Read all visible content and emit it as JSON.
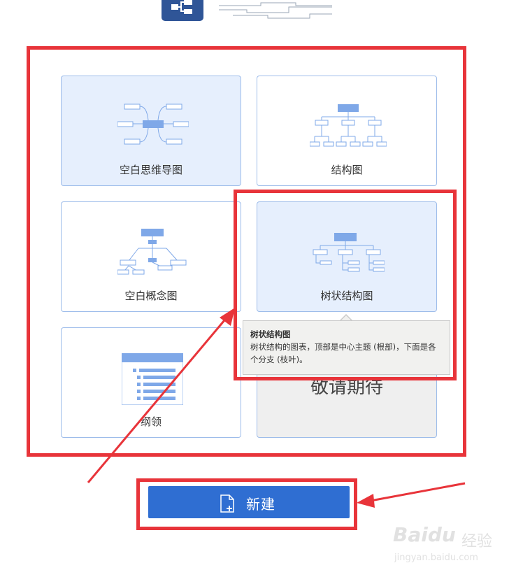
{
  "templates": [
    {
      "label": "空白思维导图",
      "icon": "mindmap-icon",
      "state": "selected"
    },
    {
      "label": "结构图",
      "icon": "org-chart-icon",
      "state": "normal"
    },
    {
      "label": "空白概念图",
      "icon": "concept-map-icon",
      "state": "normal"
    },
    {
      "label": "树状结构图",
      "icon": "tree-chart-icon",
      "state": "hovered"
    },
    {
      "label": "纲领",
      "icon": "outline-icon",
      "state": "normal"
    },
    {
      "label": "敬请期待",
      "icon": "",
      "state": "disabled"
    }
  ],
  "tooltip": {
    "title": "树状结构图",
    "description": "树状结构的图表，顶部是中心主题 (根部)，下面是各个分支 (枝叶)。"
  },
  "new_button": {
    "label": "新建",
    "icon": "new-file-icon"
  },
  "watermark": {
    "logo": "Baidu",
    "text": "经验",
    "url": "jingyan.baidu.com"
  },
  "colors": {
    "accent": "#2f6ed2",
    "annotation": "#e8343a",
    "card_border": "#9dbcea",
    "selected_bg": "#e6effd"
  }
}
